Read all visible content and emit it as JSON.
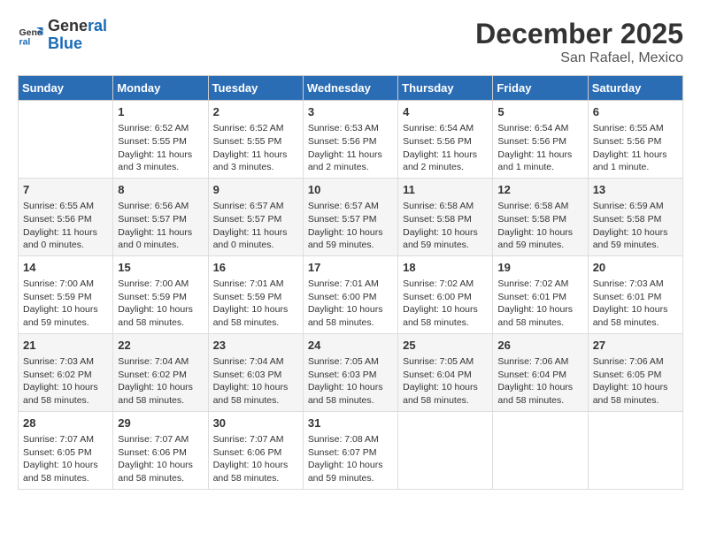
{
  "header": {
    "logo_line1": "General",
    "logo_line2": "Blue",
    "title": "December 2025",
    "subtitle": "San Rafael, Mexico"
  },
  "columns": [
    "Sunday",
    "Monday",
    "Tuesday",
    "Wednesday",
    "Thursday",
    "Friday",
    "Saturday"
  ],
  "weeks": [
    [
      {
        "day": "",
        "info": ""
      },
      {
        "day": "1",
        "info": "Sunrise: 6:52 AM\nSunset: 5:55 PM\nDaylight: 11 hours\nand 3 minutes."
      },
      {
        "day": "2",
        "info": "Sunrise: 6:52 AM\nSunset: 5:55 PM\nDaylight: 11 hours\nand 3 minutes."
      },
      {
        "day": "3",
        "info": "Sunrise: 6:53 AM\nSunset: 5:56 PM\nDaylight: 11 hours\nand 2 minutes."
      },
      {
        "day": "4",
        "info": "Sunrise: 6:54 AM\nSunset: 5:56 PM\nDaylight: 11 hours\nand 2 minutes."
      },
      {
        "day": "5",
        "info": "Sunrise: 6:54 AM\nSunset: 5:56 PM\nDaylight: 11 hours\nand 1 minute."
      },
      {
        "day": "6",
        "info": "Sunrise: 6:55 AM\nSunset: 5:56 PM\nDaylight: 11 hours\nand 1 minute."
      }
    ],
    [
      {
        "day": "7",
        "info": "Sunrise: 6:55 AM\nSunset: 5:56 PM\nDaylight: 11 hours\nand 0 minutes."
      },
      {
        "day": "8",
        "info": "Sunrise: 6:56 AM\nSunset: 5:57 PM\nDaylight: 11 hours\nand 0 minutes."
      },
      {
        "day": "9",
        "info": "Sunrise: 6:57 AM\nSunset: 5:57 PM\nDaylight: 11 hours\nand 0 minutes."
      },
      {
        "day": "10",
        "info": "Sunrise: 6:57 AM\nSunset: 5:57 PM\nDaylight: 10 hours\nand 59 minutes."
      },
      {
        "day": "11",
        "info": "Sunrise: 6:58 AM\nSunset: 5:58 PM\nDaylight: 10 hours\nand 59 minutes."
      },
      {
        "day": "12",
        "info": "Sunrise: 6:58 AM\nSunset: 5:58 PM\nDaylight: 10 hours\nand 59 minutes."
      },
      {
        "day": "13",
        "info": "Sunrise: 6:59 AM\nSunset: 5:58 PM\nDaylight: 10 hours\nand 59 minutes."
      }
    ],
    [
      {
        "day": "14",
        "info": "Sunrise: 7:00 AM\nSunset: 5:59 PM\nDaylight: 10 hours\nand 59 minutes."
      },
      {
        "day": "15",
        "info": "Sunrise: 7:00 AM\nSunset: 5:59 PM\nDaylight: 10 hours\nand 58 minutes."
      },
      {
        "day": "16",
        "info": "Sunrise: 7:01 AM\nSunset: 5:59 PM\nDaylight: 10 hours\nand 58 minutes."
      },
      {
        "day": "17",
        "info": "Sunrise: 7:01 AM\nSunset: 6:00 PM\nDaylight: 10 hours\nand 58 minutes."
      },
      {
        "day": "18",
        "info": "Sunrise: 7:02 AM\nSunset: 6:00 PM\nDaylight: 10 hours\nand 58 minutes."
      },
      {
        "day": "19",
        "info": "Sunrise: 7:02 AM\nSunset: 6:01 PM\nDaylight: 10 hours\nand 58 minutes."
      },
      {
        "day": "20",
        "info": "Sunrise: 7:03 AM\nSunset: 6:01 PM\nDaylight: 10 hours\nand 58 minutes."
      }
    ],
    [
      {
        "day": "21",
        "info": "Sunrise: 7:03 AM\nSunset: 6:02 PM\nDaylight: 10 hours\nand 58 minutes."
      },
      {
        "day": "22",
        "info": "Sunrise: 7:04 AM\nSunset: 6:02 PM\nDaylight: 10 hours\nand 58 minutes."
      },
      {
        "day": "23",
        "info": "Sunrise: 7:04 AM\nSunset: 6:03 PM\nDaylight: 10 hours\nand 58 minutes."
      },
      {
        "day": "24",
        "info": "Sunrise: 7:05 AM\nSunset: 6:03 PM\nDaylight: 10 hours\nand 58 minutes."
      },
      {
        "day": "25",
        "info": "Sunrise: 7:05 AM\nSunset: 6:04 PM\nDaylight: 10 hours\nand 58 minutes."
      },
      {
        "day": "26",
        "info": "Sunrise: 7:06 AM\nSunset: 6:04 PM\nDaylight: 10 hours\nand 58 minutes."
      },
      {
        "day": "27",
        "info": "Sunrise: 7:06 AM\nSunset: 6:05 PM\nDaylight: 10 hours\nand 58 minutes."
      }
    ],
    [
      {
        "day": "28",
        "info": "Sunrise: 7:07 AM\nSunset: 6:05 PM\nDaylight: 10 hours\nand 58 minutes."
      },
      {
        "day": "29",
        "info": "Sunrise: 7:07 AM\nSunset: 6:06 PM\nDaylight: 10 hours\nand 58 minutes."
      },
      {
        "day": "30",
        "info": "Sunrise: 7:07 AM\nSunset: 6:06 PM\nDaylight: 10 hours\nand 58 minutes."
      },
      {
        "day": "31",
        "info": "Sunrise: 7:08 AM\nSunset: 6:07 PM\nDaylight: 10 hours\nand 59 minutes."
      },
      {
        "day": "",
        "info": ""
      },
      {
        "day": "",
        "info": ""
      },
      {
        "day": "",
        "info": ""
      }
    ]
  ]
}
